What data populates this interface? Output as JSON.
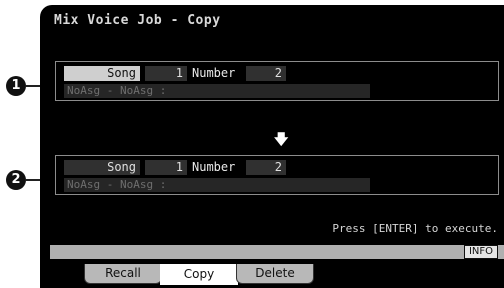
{
  "title": "Mix Voice Job - Copy",
  "source": {
    "callout": "1",
    "type": "Song",
    "number_a": "1",
    "number_label": "Number",
    "number_b": "2",
    "ref": "NoAsg - NoAsg :"
  },
  "destination": {
    "callout": "2",
    "type": "Song",
    "number_a": "1",
    "number_label": "Number",
    "number_b": "2",
    "ref": "NoAsg - NoAsg :"
  },
  "arrow": "🡇",
  "hint": "Press [ENTER] to execute.",
  "info_label": "INFO",
  "tabs": [
    {
      "label": "Recall"
    },
    {
      "label": "Copy"
    },
    {
      "label": "Delete"
    }
  ]
}
